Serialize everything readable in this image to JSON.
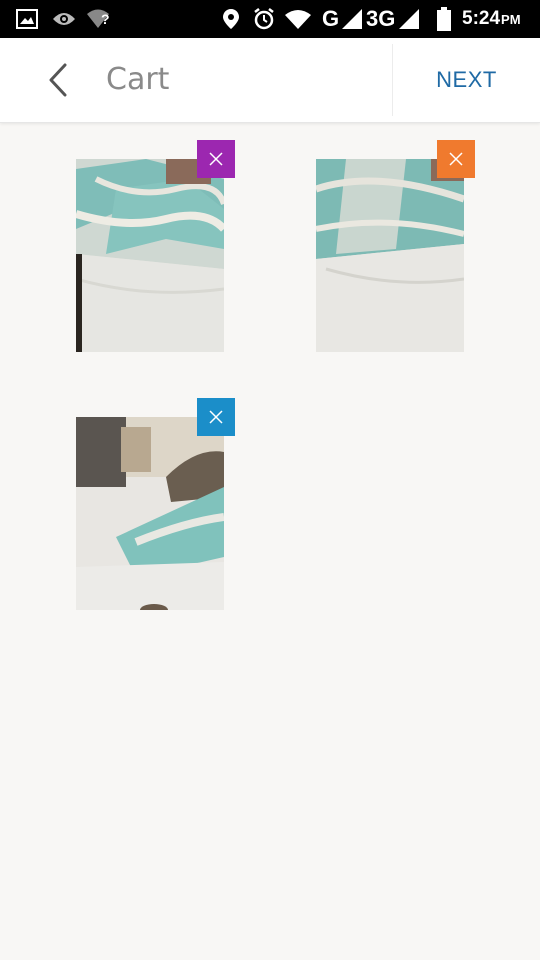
{
  "status_bar": {
    "time": "5:24",
    "ampm": "PM",
    "network_g": "G",
    "network_3g": "3G",
    "wifi_unknown": "?",
    "icons": [
      "gallery-icon",
      "eye-icon",
      "wifi-question-icon",
      "location-icon",
      "alarm-icon",
      "wifi-icon",
      "signal-icon",
      "battery-icon"
    ]
  },
  "app_bar": {
    "back_icon": "chevron-left-icon",
    "title": "Cart",
    "next_label": "NEXT"
  },
  "cart": {
    "items": [
      {
        "accent": "#9c27b0",
        "remove_icon": "close-icon"
      },
      {
        "accent": "#f07a2e",
        "remove_icon": "close-icon"
      },
      {
        "accent": "#1b8ec9",
        "remove_icon": "close-icon"
      }
    ]
  },
  "colors": {
    "accent_next": "#1f6aa5",
    "title_text": "#8a8a8a",
    "background": "#f8f7f5"
  }
}
